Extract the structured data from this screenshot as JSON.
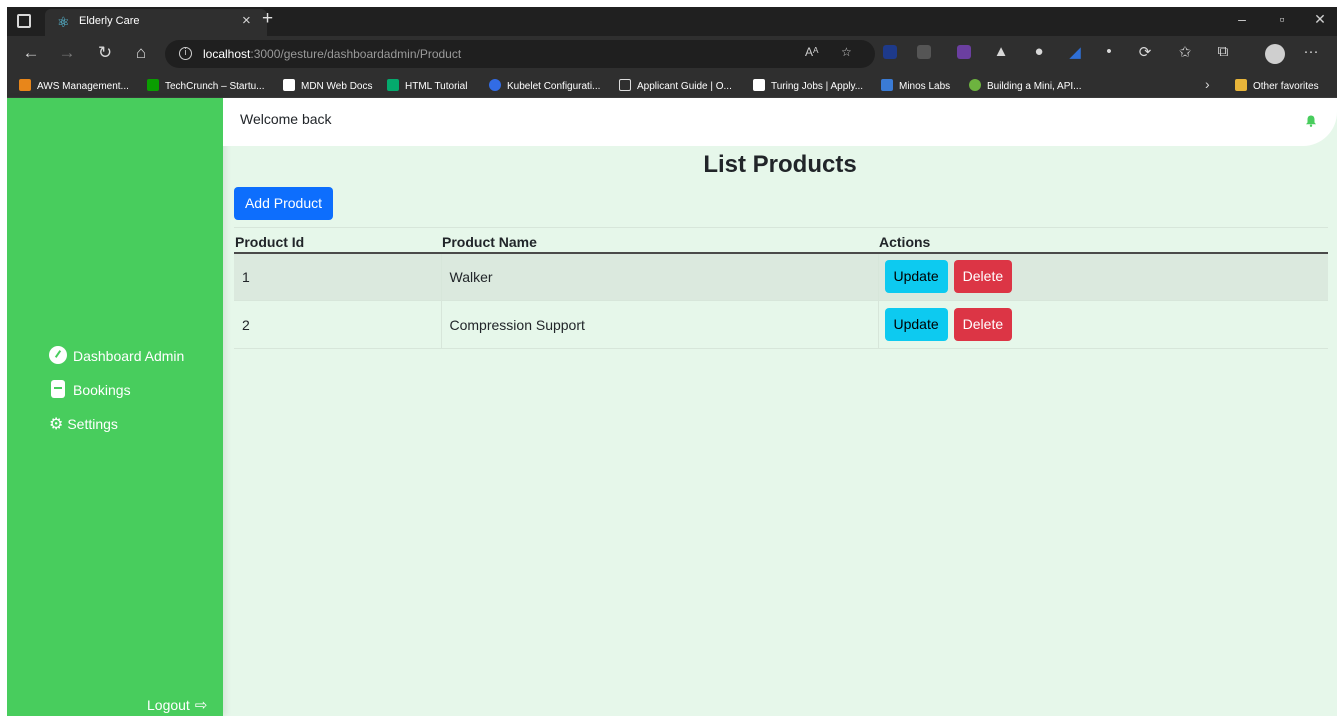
{
  "browser": {
    "tab_title": "Elderly Care",
    "url_host": "localhost",
    "url_rest": ":3000/gesture/dashboardadmin/Product",
    "favorites": [
      {
        "label": "AWS Management...",
        "color": "#e8861a"
      },
      {
        "label": "TechCrunch – Startu...",
        "color": "#0a9e01"
      },
      {
        "label": "MDN Web Docs",
        "color": "#ffffff"
      },
      {
        "label": "HTML Tutorial",
        "color": "#04aa6d"
      },
      {
        "label": "Kubelet Configurati...",
        "color": "#326ce5"
      },
      {
        "label": "Applicant Guide | O...",
        "color": "#2f2f2f"
      },
      {
        "label": "Turing Jobs | Apply...",
        "color": "#ffffff"
      },
      {
        "label": "Minos Labs",
        "color": "#3a7bd5"
      },
      {
        "label": "Building a Mini, API...",
        "color": "#6db33f"
      }
    ],
    "other_favorites": "Other favorites"
  },
  "sidebar": {
    "items": [
      {
        "label": "Dashboard Admin",
        "icon": "tachometer-icon"
      },
      {
        "label": "Bookings",
        "icon": "book-icon"
      },
      {
        "label": "Settings",
        "icon": "cogs-icon"
      }
    ],
    "logout": "Logout"
  },
  "header": {
    "welcome": "Welcome back"
  },
  "main": {
    "title": "List Products",
    "add_button": "Add Product",
    "columns": [
      "Product Id",
      "Product Name",
      "Actions"
    ],
    "rows": [
      {
        "id": "1",
        "name": "Walker"
      },
      {
        "id": "2",
        "name": "Compression Support"
      }
    ],
    "update_label": "Update",
    "delete_label": "Delete"
  },
  "colors": {
    "sidebar": "#48cd5d",
    "page_bg": "#e6f7ea",
    "primary": "#0d6efd",
    "info": "#0dcaf0",
    "danger": "#dc3545"
  }
}
